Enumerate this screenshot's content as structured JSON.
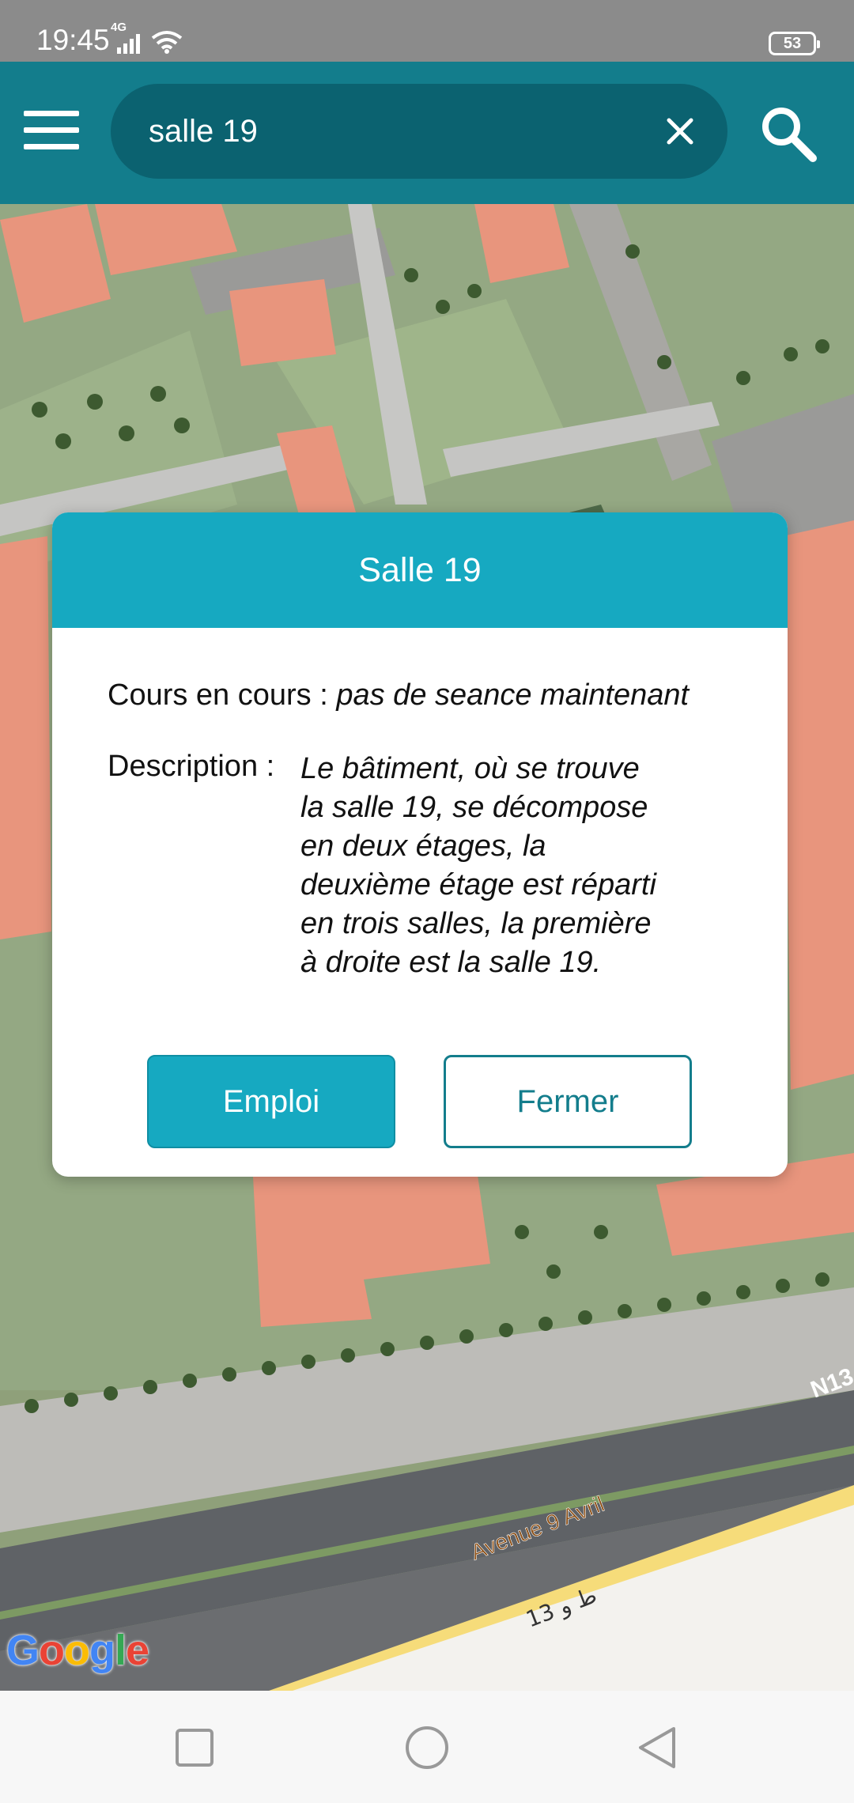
{
  "status_bar": {
    "time": "19:45",
    "network": "4G",
    "battery": "53"
  },
  "search": {
    "value": "salle 19",
    "icons": {
      "menu": "hamburger-menu-icon",
      "clear": "close-icon",
      "search": "search-icon"
    }
  },
  "map": {
    "road_label_fr": "Avenue 9 Avril",
    "road_label_ar": "ط و 13",
    "road_code": "N13",
    "google_letters": [
      "G",
      "o",
      "o",
      "g",
      "l",
      "e"
    ],
    "google_colors": [
      "#4285F4",
      "#EA4335",
      "#FBBC05",
      "#4285F4",
      "#34A853",
      "#EA4335"
    ]
  },
  "dialog": {
    "title": "Salle 19",
    "cours_label": "Cours en cours :",
    "cours_value": "pas de seance maintenant",
    "description_label": "Description :",
    "description_lines": [
      "Le bâtiment, où se trouve",
      "la salle 19, se décompose",
      "en deux étages, la",
      "deuxième étage est réparti",
      "en trois salles, la première",
      "à droite est la salle 19."
    ],
    "emploi_button": "Emploi",
    "fermer_button": "Fermer"
  },
  "navigation": {
    "icons": [
      "recents-square-icon",
      "home-circle-icon",
      "back-triangle-icon"
    ]
  },
  "colors": {
    "app_bar": "#137d8c",
    "search_field": "#0b6270",
    "dialog_header": "#16a9c1",
    "primary_button": "#16a9c1",
    "building": "#e8957d"
  }
}
